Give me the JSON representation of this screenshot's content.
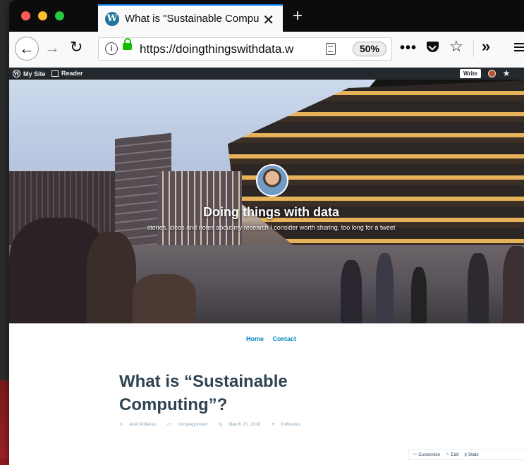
{
  "browser": {
    "tab_title": "What is \"Sustainable Computing",
    "tab_close_glyph": "✕",
    "new_tab_glyph": "+",
    "url_host": "https://doingthingswithdata.w",
    "zoom_level": "50%",
    "page_actions_glyph": "•••",
    "overflow_glyph": "»"
  },
  "admin_bar": {
    "my_site_label": "My Site",
    "reader_label": "Reader",
    "write_label": "Write"
  },
  "site": {
    "title": "Doing things with data",
    "tagline": "stories, ideas and notes about my research I consider worth sharing, too long for a tweet",
    "nav": [
      {
        "label": "Home"
      },
      {
        "label": "Contact"
      }
    ]
  },
  "post": {
    "title": "What is “Sustainable Computing”?",
    "author": "Axel Polleres",
    "category": "Uncategorized",
    "date": "March 20, 2018",
    "read_time": "3 Minutes"
  },
  "edit_bar": {
    "customize_label": "Customize",
    "edit_label": "Edit",
    "stats_label": "Stats"
  },
  "colors": {
    "accent_blue": "#0a84ff",
    "link_blue": "#0087be",
    "lock_green": "#12bc00",
    "admin_bar": "#23282d"
  }
}
